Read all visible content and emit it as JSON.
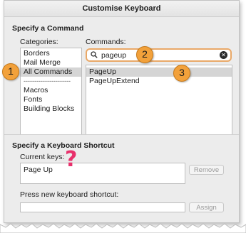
{
  "window": {
    "title": "Customise Keyboard"
  },
  "command_section": {
    "heading": "Specify a Command",
    "categories_label": "Categories:",
    "commands_label": "Commands:",
    "categories": [
      "Borders",
      "Mail Merge",
      "All Commands",
      "----------------------",
      "Macros",
      "Fonts",
      "Building Blocks"
    ],
    "selected_category": "All Commands",
    "search": {
      "value": "pageup",
      "clear_icon": "x-circle-icon"
    },
    "commands": [
      "PageUp",
      "PageUpExtend"
    ],
    "selected_command": "PageUp"
  },
  "shortcut_section": {
    "heading": "Specify a Keyboard Shortcut",
    "current_keys_label": "Current keys:",
    "current_keys": [
      "Page Up"
    ],
    "remove_label": "Remove",
    "new_shortcut_label": "Press new keyboard shortcut:",
    "new_shortcut_value": "",
    "assign_label": "Assign"
  },
  "annotations": {
    "badge1": "1",
    "badge2": "2",
    "badge3": "3",
    "question_mark": "?"
  },
  "colors": {
    "badge": "#f2a13b",
    "focus_ring": "#e9a867",
    "question_mark": "#e8306b"
  }
}
